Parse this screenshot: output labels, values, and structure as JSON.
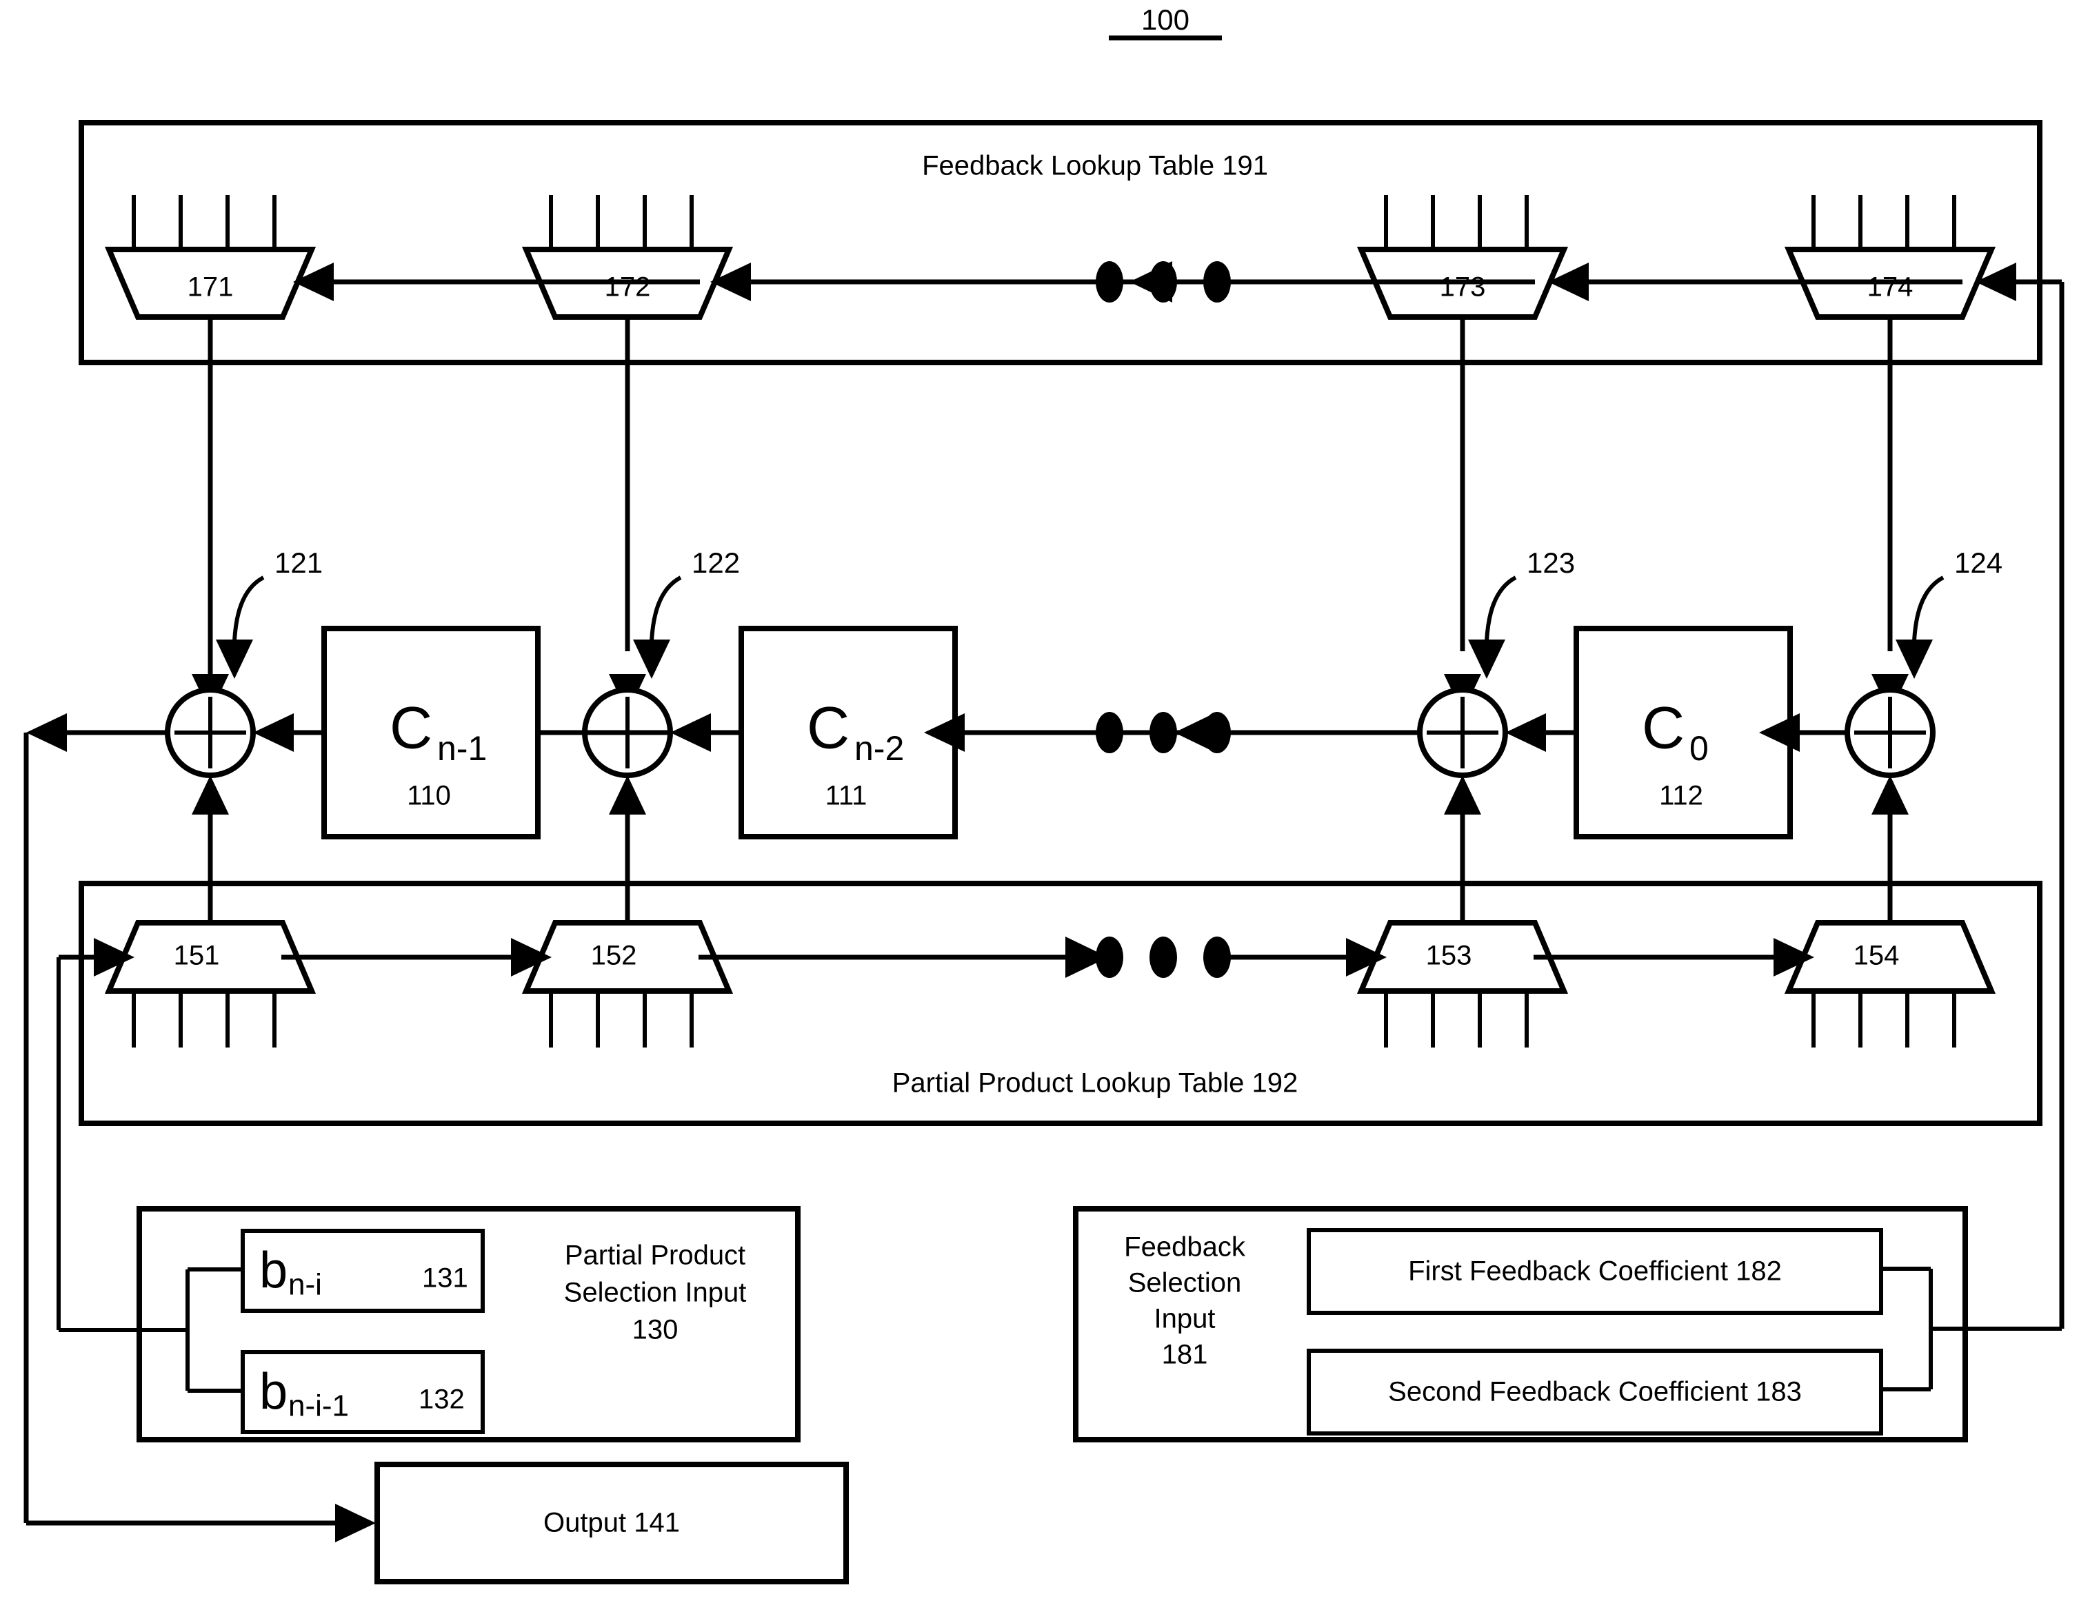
{
  "figure": {
    "number": "100"
  },
  "feedback_table": {
    "label": "Feedback Lookup Table 191"
  },
  "partial_table": {
    "label": "Partial Product Lookup Table 192"
  },
  "feedback_muxes": [
    {
      "id": "171",
      "label": "171"
    },
    {
      "id": "172",
      "label": "172"
    },
    {
      "id": "173",
      "label": "173"
    },
    {
      "id": "174",
      "label": "174"
    }
  ],
  "partial_muxes": [
    {
      "id": "151",
      "label": "151"
    },
    {
      "id": "152",
      "label": "152"
    },
    {
      "id": "153",
      "label": "153"
    },
    {
      "id": "154",
      "label": "154"
    }
  ],
  "adders": [
    {
      "id": "121",
      "label": "121",
      "symbol": "+"
    },
    {
      "id": "122",
      "label": "122",
      "symbol": "+"
    },
    {
      "id": "123",
      "label": "123",
      "symbol": "+"
    },
    {
      "id": "124",
      "label": "124",
      "symbol": "+"
    }
  ],
  "coefficient_blocks": [
    {
      "base": "C",
      "sub": "n-1",
      "ref": "110"
    },
    {
      "base": "C",
      "sub": "n-2",
      "ref": "111"
    },
    {
      "base": "C",
      "sub": "0",
      "ref": "112"
    }
  ],
  "partial_product_selection": {
    "title_line1": "Partial Product",
    "title_line2": "Selection Input",
    "title_line3": "130",
    "bits": [
      {
        "base": "b",
        "sub": "n-i",
        "ref": "131"
      },
      {
        "base": "b",
        "sub": "n-i-1",
        "ref": "132"
      }
    ]
  },
  "feedback_selection": {
    "title_line1": "Feedback",
    "title_line2": "Selection",
    "title_line3": "Input",
    "title_line4": "181",
    "coefficients": [
      {
        "label": "First Feedback Coefficient 182"
      },
      {
        "label": "Second Feedback Coefficient 183"
      }
    ]
  },
  "output": {
    "label": "Output 141"
  },
  "ellipsis": {
    "dot_count": 3
  },
  "colors": {
    "stroke": "#000000",
    "background": "#ffffff"
  }
}
